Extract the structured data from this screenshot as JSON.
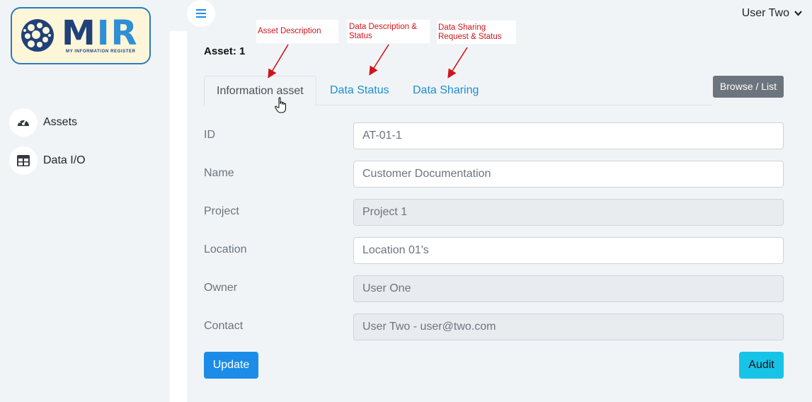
{
  "logo": {
    "brand_m": "M",
    "brand_ir": "IR",
    "subtitle": "MY INFORMATION REGISTER"
  },
  "sidebar": {
    "items": [
      {
        "label": "Assets",
        "icon": "dashboard-gauge-icon"
      },
      {
        "label": "Data I/O",
        "icon": "table-icon"
      }
    ]
  },
  "header": {
    "menu_icon": "hamburger-icon",
    "user_name": "User Two",
    "user_icon": "chevron-down-icon"
  },
  "asset": {
    "title": "Asset: 1"
  },
  "tabs": [
    {
      "label": "Information asset",
      "active": true
    },
    {
      "label": "Data Status",
      "active": false
    },
    {
      "label": "Data Sharing",
      "active": false
    }
  ],
  "browse_button": "Browse / List",
  "form": {
    "id": {
      "label": "ID",
      "value": "AT-01-1"
    },
    "name": {
      "label": "Name",
      "value": "Customer Documentation"
    },
    "project": {
      "label": "Project",
      "value": "Project 1"
    },
    "location": {
      "label": "Location",
      "value": "Location 01's"
    },
    "owner": {
      "label": "Owner",
      "value": "User One"
    },
    "contact": {
      "label": "Contact",
      "value": "User Two - user@two.com"
    }
  },
  "buttons": {
    "update": "Update",
    "audit": "Audit"
  },
  "annotations": {
    "asset_description": "Asset Description",
    "data_description_line1": "Data Description &",
    "data_description_line2": "Status",
    "data_sharing_line1": "Data Sharing",
    "data_sharing_line2": "Request & Status"
  },
  "colors": {
    "primary": "#1b8ce8",
    "info": "#17c4e8",
    "secondary": "#6c757d",
    "link": "#1b8fcf",
    "annotation": "#d0141c",
    "brand_dark": "#20417a",
    "brand_light": "#2f8fd4"
  }
}
